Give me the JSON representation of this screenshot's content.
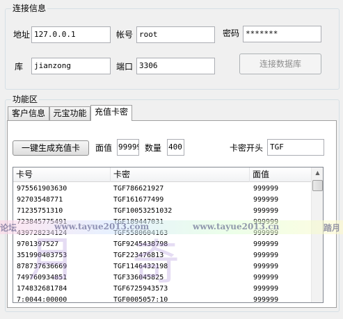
{
  "connection": {
    "title": "连接信息",
    "address_label": "地址",
    "address_value": "127.0.0.1",
    "account_label": "帐号",
    "account_value": "root",
    "password_label": "密码",
    "password_value": "*******",
    "db_label": "库",
    "db_value": "jianzong",
    "port_label": "端口",
    "port_value": "3306",
    "connect_button": "连接数据库"
  },
  "functions": {
    "title": "功能区",
    "tabs": [
      {
        "label": "客户信息"
      },
      {
        "label": "元宝功能"
      },
      {
        "label": "充值卡密"
      }
    ],
    "active_tab": "充值卡密",
    "generate_button": "一键生成充值卡",
    "face_value_label": "面值",
    "face_value": "99999",
    "quantity_label": "数量",
    "quantity": "400",
    "prefix_label": "卡密开头",
    "prefix_value": "TGF"
  },
  "table": {
    "columns": [
      "卡号",
      "卡密",
      "面值"
    ],
    "rows": [
      [
        "975561903630",
        "TGF786621927",
        "999999"
      ],
      [
        "92703548771",
        "TGF161677499",
        "999999"
      ],
      [
        "71235751310",
        "TGF10053251032",
        "999999"
      ],
      [
        "723845775491",
        "TGF189447031",
        "999999"
      ],
      [
        "439728234124",
        "TGF5580604163",
        "999999"
      ],
      [
        "9701397527",
        "TGF9245438798",
        "999999"
      ],
      [
        "351990403753",
        "TGF223476813",
        "999999"
      ],
      [
        "878737636669",
        "TGF1146432198",
        "999999"
      ],
      [
        "749760934851",
        "TGF336045825",
        "999999"
      ],
      [
        "174832681784",
        "TGF6725943573",
        "999999"
      ],
      [
        "7:0044:00000",
        "TGF0005057:10",
        "999999"
      ]
    ]
  },
  "watermark": {
    "left_fragment": "论坛",
    "url_1": "www.tayue2013.com",
    "url_2": "www.tayue2013.cn",
    "right_fragment": "踏月",
    "big_char_1": "月",
    "big_char_2": "奇"
  }
}
